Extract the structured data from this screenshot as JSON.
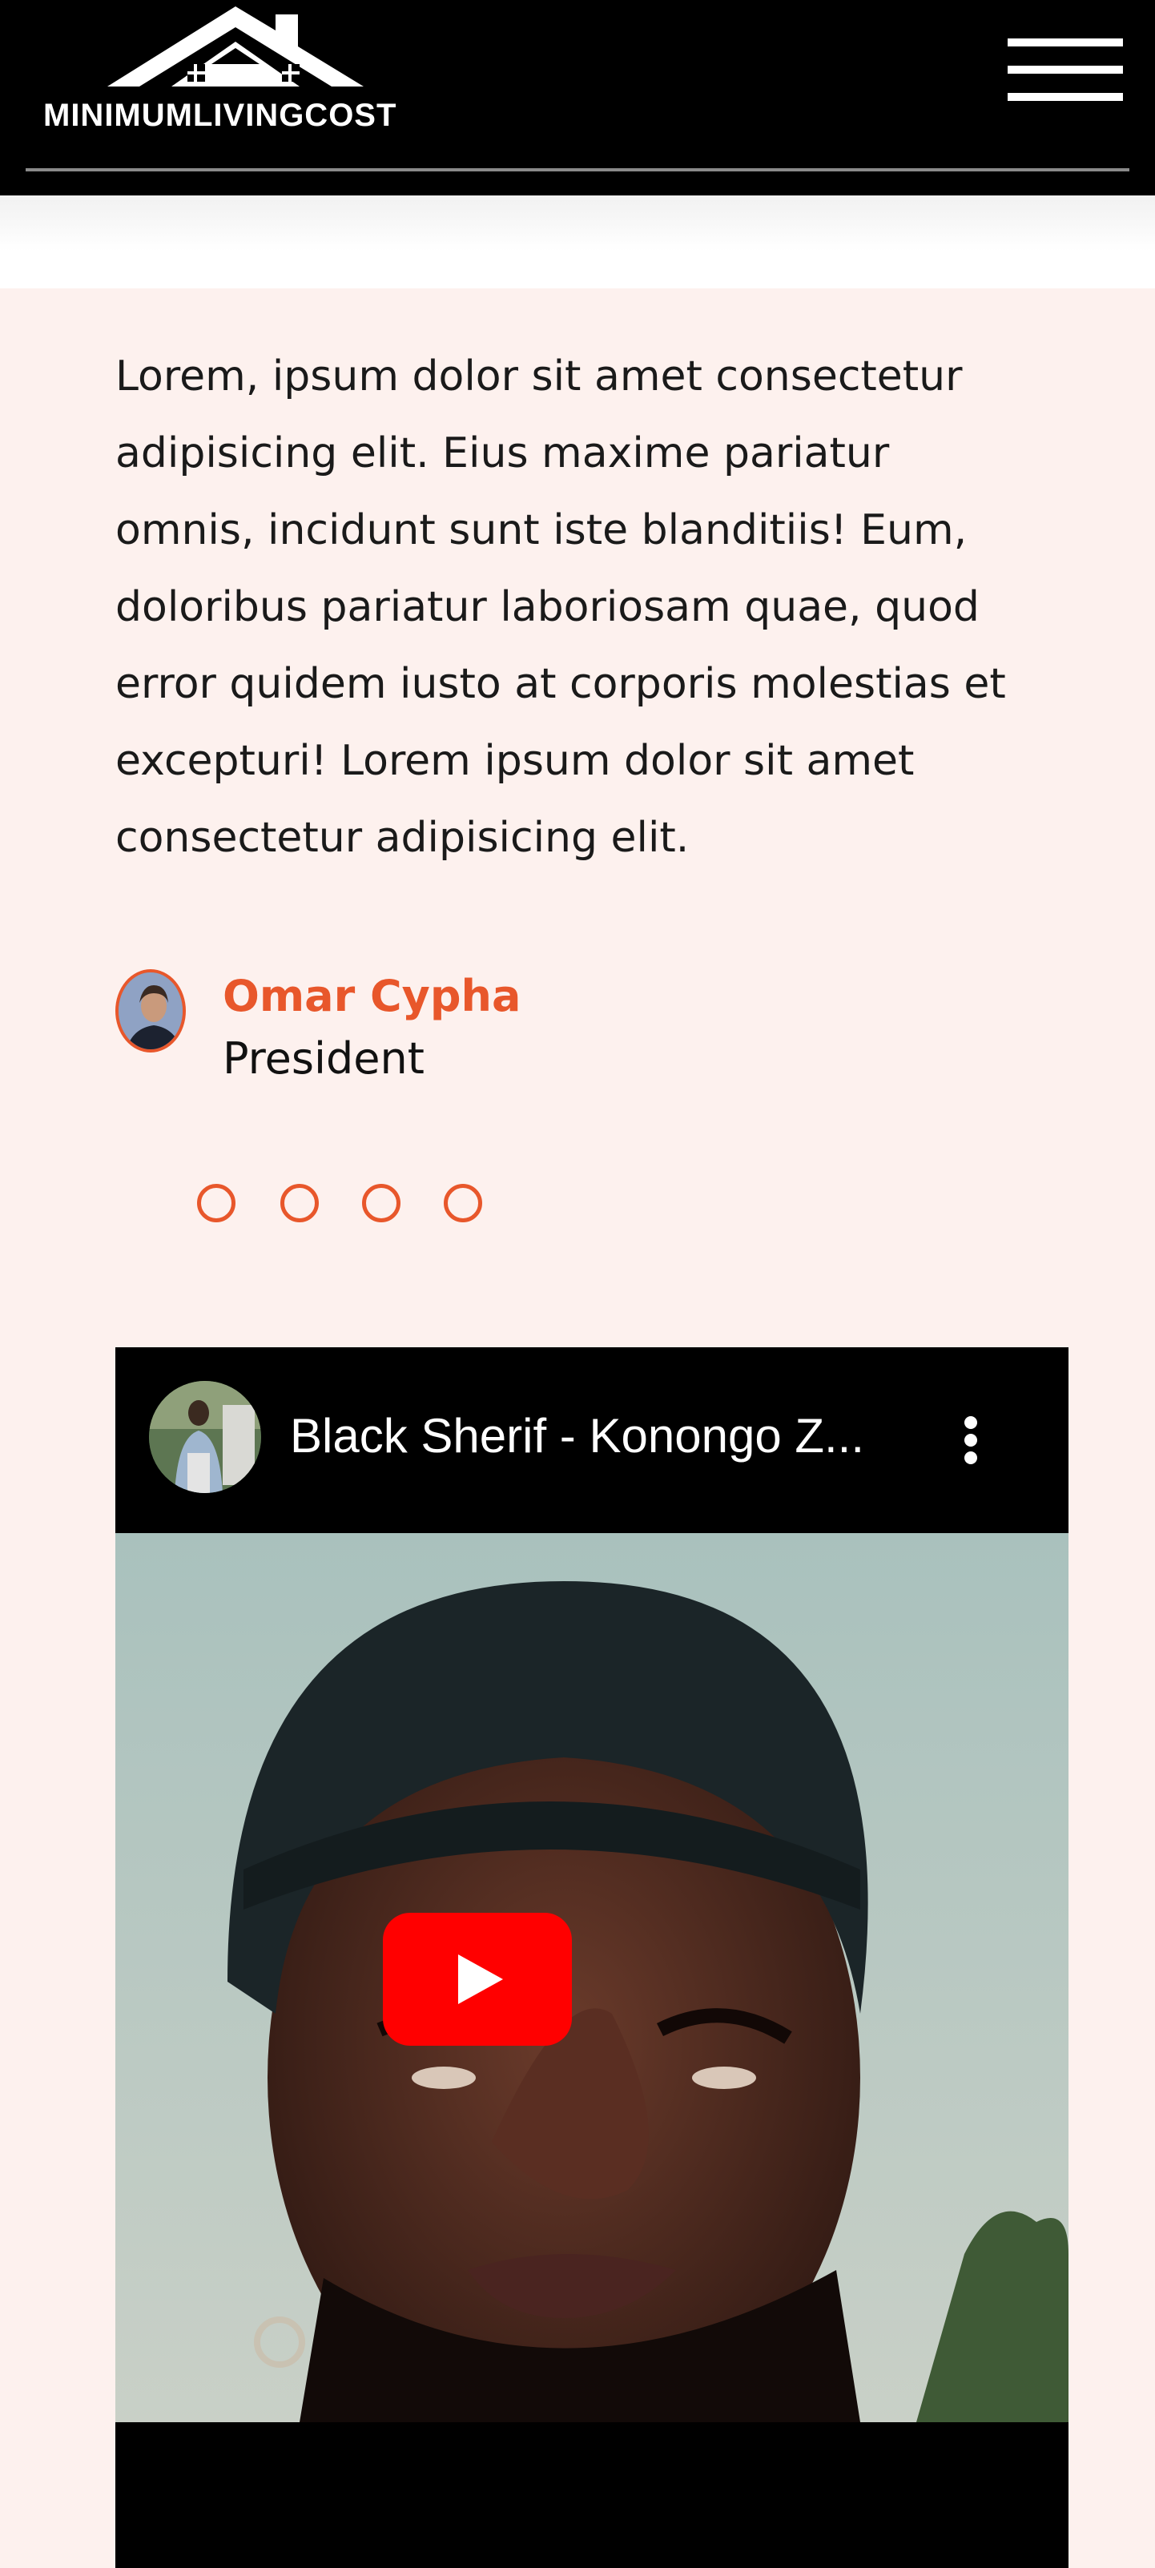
{
  "header": {
    "logo_text": "MINIMUMLIVINGCOST",
    "menu_icon": "hamburger-icon"
  },
  "testimonial": {
    "quote": "Lorem, ipsum dolor sit amet consectetur adipisicing elit. Eius maxime pariatur omnis, incidunt sunt iste blanditiis! Eum, doloribus pariatur laboriosam quae, quod error quidem iusto at corporis molestias et excepturi! Lorem ipsum dolor sit amet consectetur adipisicing elit.",
    "author_name": "Omar Cypha",
    "author_role": "President",
    "slide_count": 4,
    "accent_color": "#e8572b"
  },
  "video": {
    "title": "Black Sherif - Konongo Z...",
    "play_icon": "youtube-play-icon",
    "more_icon": "more-vertical-icon"
  },
  "colors": {
    "header_bg": "#000000",
    "section_bg": "#fdf1ee",
    "accent": "#e8572b",
    "youtube_red": "#ff0000"
  }
}
